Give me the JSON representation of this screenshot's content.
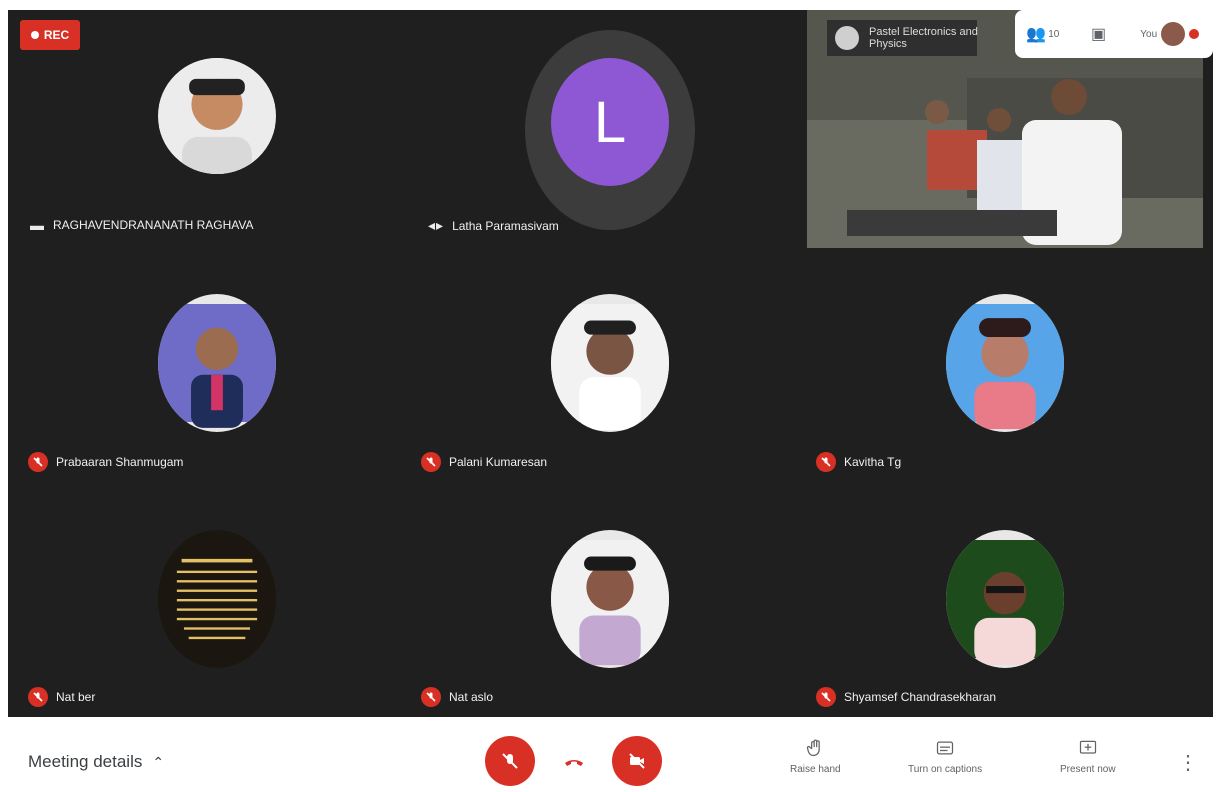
{
  "recording": {
    "label": "REC"
  },
  "participants": [
    {
      "name": "RAGHAVENDRANANATH RAGHAVA",
      "muted": false,
      "avatar": "photo"
    },
    {
      "name": "Latha Paramasivam",
      "muted": false,
      "avatar": "letter",
      "initial": "L"
    },
    {
      "name": "Prabaaran Shanmugam",
      "muted": true,
      "avatar": "photo"
    },
    {
      "name": "Palani Kumaresan",
      "muted": true,
      "avatar": "photo"
    },
    {
      "name": "Kavitha Tg",
      "muted": true,
      "avatar": "photo"
    },
    {
      "name": "Nat ber",
      "muted": true,
      "avatar": "text-image"
    },
    {
      "name": "Nat aslo",
      "muted": true,
      "avatar": "photo"
    },
    {
      "name": "Shyamsef Chandrasekharan",
      "muted": true,
      "avatar": "photo"
    }
  ],
  "presenter_video": {
    "banner": "Pastel Electronics and Physics"
  },
  "top_panel": {
    "you_label": "You",
    "people_count": "10"
  },
  "toolbar": {
    "meeting_details": "Meeting details",
    "raise_hand": "Raise hand",
    "turn_on_captions": "Turn on captions",
    "present_now": "Present now"
  },
  "colors": {
    "stage": "#1f1f1f",
    "danger": "#d93025",
    "letter_avatar": "#8e57d4",
    "toolbar": "#ffffff"
  }
}
